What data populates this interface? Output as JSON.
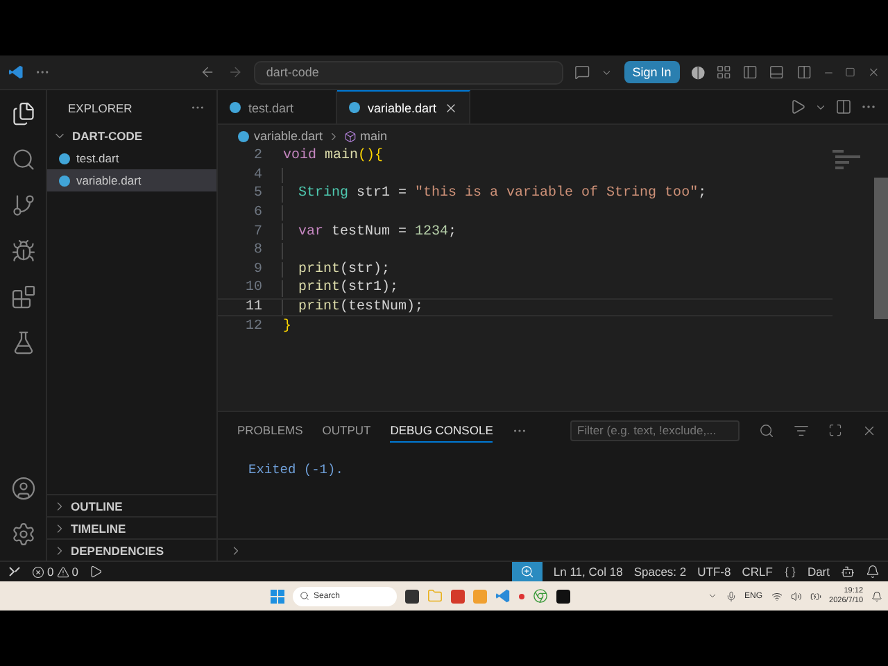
{
  "title_bar": {
    "search": "dart-code",
    "sign_in": "Sign In"
  },
  "sidebar": {
    "title": "EXPLORER",
    "folder": "DART-CODE",
    "files": [
      {
        "name": "test.dart",
        "selected": false
      },
      {
        "name": "variable.dart",
        "selected": true
      }
    ],
    "sections": [
      "OUTLINE",
      "TIMELINE",
      "DEPENDENCIES"
    ]
  },
  "tabs": [
    {
      "label": "test.dart",
      "selected": false
    },
    {
      "label": "variable.dart",
      "selected": true
    }
  ],
  "breadcrumb": {
    "file": "variable.dart",
    "symbol": "main"
  },
  "code": [
    {
      "number": "2",
      "current": false,
      "indented": false,
      "tokens": [
        {
          "text": "void ",
          "kind": "keyword"
        },
        {
          "text": "main",
          "kind": "func"
        },
        {
          "text": "(){",
          "kind": "bracket"
        }
      ]
    },
    {
      "number": "4",
      "current": false,
      "indented": true
    },
    {
      "number": "5",
      "current": false,
      "indented": true,
      "tokens": [
        {
          "text": "String",
          "kind": "type"
        },
        {
          "text": " str1 = ",
          "kind": "plain"
        },
        {
          "text": "\"this is a variable of String too\"",
          "kind": "string"
        },
        {
          "text": ";",
          "kind": "plain"
        }
      ]
    },
    {
      "number": "6",
      "current": false,
      "indented": true
    },
    {
      "number": "7",
      "current": false,
      "indented": true,
      "tokens": [
        {
          "text": "var",
          "kind": "keyword"
        },
        {
          "text": " testNum = ",
          "kind": "plain"
        },
        {
          "text": "1234",
          "kind": "number"
        },
        {
          "text": ";",
          "kind": "plain"
        }
      ]
    },
    {
      "number": "8",
      "current": false,
      "indented": true
    },
    {
      "number": "9",
      "current": false,
      "indented": true,
      "tokens": [
        {
          "text": "print",
          "kind": "func"
        },
        {
          "text": "(str);",
          "kind": "plain"
        }
      ]
    },
    {
      "number": "10",
      "current": false,
      "indented": true,
      "tokens": [
        {
          "text": "print",
          "kind": "func"
        },
        {
          "text": "(str1);",
          "kind": "plain"
        }
      ]
    },
    {
      "number": "11",
      "current": true,
      "indented": true,
      "tokens": [
        {
          "text": "print",
          "kind": "func"
        },
        {
          "text": "(testNum);",
          "kind": "plain"
        }
      ]
    },
    {
      "number": "12",
      "current": false,
      "indented": false,
      "tokens": [
        {
          "text": "}",
          "kind": "bracket"
        }
      ]
    }
  ],
  "panel": {
    "tabs": [
      {
        "label": "PROBLEMS",
        "selected": false
      },
      {
        "label": "OUTPUT",
        "selected": false
      },
      {
        "label": "DEBUG CONSOLE",
        "selected": true
      }
    ],
    "filter": {
      "placeholder": "Filter (e.g. text, !exclude,..."
    },
    "output": "Exited (-1)."
  },
  "status_bar": {
    "errors": "0",
    "warnings": "0",
    "position": "Ln 11, Col 18",
    "spaces": "Spaces: 2",
    "encoding": "UTF-8",
    "eol": "CRLF",
    "language": "Dart"
  },
  "taskbar": {
    "search": "Search",
    "language": "ENG",
    "time": "19:12",
    "date": "2026/7/10"
  }
}
